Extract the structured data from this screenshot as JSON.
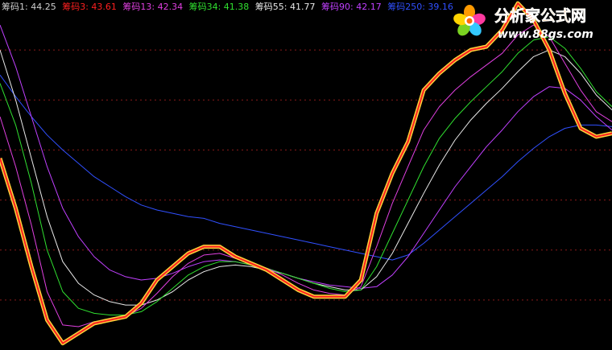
{
  "colors": {
    "background": "#000000",
    "grid": "#8a1a1a"
  },
  "legend": [
    {
      "label": "筹码1: 44.25",
      "color": "#cfcfcf"
    },
    {
      "label": "筹码3: 43.61",
      "color": "#ff2020"
    },
    {
      "label": "筹码13: 42.34",
      "color": "#e040e0"
    },
    {
      "label": "筹码34: 41.38",
      "color": "#30e030"
    },
    {
      "label": "筹码55: 41.77",
      "color": "#e8e8e8"
    },
    {
      "label": "筹码90: 42.17",
      "color": "#c040ff"
    },
    {
      "label": "筹码250: 39.16",
      "color": "#3050ff"
    }
  ],
  "watermark": {
    "site_name": "分析家公式网",
    "url": "www.88gs.com",
    "icon": "flower-logo-icon"
  },
  "chart_data": {
    "type": "line",
    "grid": "horizontal-dashed",
    "legend_placement": "top-left",
    "ylim": [
      30,
      51
    ],
    "x": [
      0,
      4,
      8,
      12,
      16,
      20,
      24,
      28,
      32,
      36,
      40,
      44,
      48,
      52,
      56,
      60,
      64,
      68,
      72,
      76,
      80,
      84,
      88,
      92,
      96,
      100,
      104,
      108,
      112,
      116,
      120,
      124,
      128,
      132,
      136,
      140,
      144,
      148,
      152,
      156
    ],
    "series": [
      {
        "name": "筹码1",
        "color": "#ffd23a",
        "thick": true,
        "values": [
          41.5,
          38.5,
          35.0,
          31.8,
          30.4,
          31.0,
          31.6,
          31.8,
          32.0,
          32.8,
          34.2,
          35.0,
          35.8,
          36.2,
          36.2,
          35.6,
          35.2,
          34.8,
          34.2,
          33.6,
          33.2,
          33.2,
          33.2,
          34.2,
          38.2,
          40.6,
          42.5,
          45.6,
          46.6,
          47.4,
          48.0,
          48.2,
          49.2,
          50.8,
          49.8,
          48.0,
          45.4,
          43.3,
          42.8,
          43.0
        ]
      },
      {
        "name": "筹码3",
        "color": "#ff2020",
        "thick": true,
        "values": [
          41.5,
          38.5,
          35.0,
          31.8,
          30.4,
          31.0,
          31.6,
          31.8,
          32.0,
          32.8,
          34.2,
          35.0,
          35.8,
          36.2,
          36.2,
          35.6,
          35.2,
          34.8,
          34.2,
          33.6,
          33.2,
          33.2,
          33.2,
          34.2,
          38.2,
          40.6,
          42.5,
          45.6,
          46.6,
          47.4,
          48.0,
          48.2,
          49.2,
          50.8,
          49.8,
          48.0,
          45.4,
          43.3,
          42.8,
          43.0
        ]
      },
      {
        "name": "筹码13",
        "color": "#e040e0",
        "values": [
          44.0,
          41.0,
          37.5,
          33.5,
          31.5,
          31.4,
          31.7,
          31.8,
          32.0,
          32.5,
          33.4,
          34.4,
          35.2,
          35.7,
          35.8,
          35.5,
          35.2,
          34.9,
          34.5,
          34.0,
          33.6,
          33.4,
          33.3,
          33.8,
          36.2,
          38.8,
          41.0,
          43.2,
          44.6,
          45.6,
          46.4,
          47.1,
          47.8,
          48.9,
          49.5,
          48.8,
          47.2,
          45.6,
          44.3,
          43.7
        ]
      },
      {
        "name": "筹码34",
        "color": "#30e030",
        "values": [
          46.0,
          43.5,
          40.0,
          36.0,
          33.5,
          32.5,
          32.2,
          32.1,
          32.1,
          32.3,
          32.9,
          33.7,
          34.5,
          35.0,
          35.3,
          35.3,
          35.1,
          34.9,
          34.6,
          34.3,
          34.0,
          33.7,
          33.5,
          33.6,
          35.0,
          37.0,
          39.0,
          41.0,
          42.7,
          43.9,
          44.9,
          45.8,
          46.7,
          47.8,
          48.6,
          48.8,
          48.1,
          46.9,
          45.5,
          44.6
        ]
      },
      {
        "name": "筹码55",
        "color": "#e8e8e8",
        "values": [
          48.0,
          45.0,
          41.5,
          38.0,
          35.3,
          34.0,
          33.3,
          32.9,
          32.7,
          32.7,
          33.0,
          33.5,
          34.2,
          34.7,
          35.0,
          35.1,
          35.0,
          34.8,
          34.6,
          34.3,
          34.0,
          33.8,
          33.6,
          33.6,
          34.4,
          35.8,
          37.6,
          39.4,
          41.1,
          42.6,
          43.8,
          44.8,
          45.7,
          46.7,
          47.6,
          48.0,
          47.6,
          46.6,
          45.3,
          44.4
        ]
      },
      {
        "name": "筹码90",
        "color": "#c040ff",
        "values": [
          49.5,
          47.0,
          44.0,
          41.0,
          38.5,
          36.8,
          35.6,
          34.8,
          34.4,
          34.2,
          34.3,
          34.6,
          35.0,
          35.3,
          35.4,
          35.3,
          35.1,
          34.9,
          34.6,
          34.3,
          34.1,
          33.9,
          33.8,
          33.7,
          33.8,
          34.5,
          35.6,
          37.0,
          38.4,
          39.8,
          41.0,
          42.2,
          43.2,
          44.3,
          45.2,
          45.8,
          45.7,
          45.0,
          44.0,
          43.2
        ]
      },
      {
        "name": "筹码250",
        "color": "#3050ff",
        "values": [
          46.5,
          45.2,
          44.0,
          42.9,
          42.0,
          41.2,
          40.4,
          39.8,
          39.2,
          38.7,
          38.4,
          38.2,
          38.0,
          37.9,
          37.6,
          37.4,
          37.2,
          37.0,
          36.8,
          36.6,
          36.4,
          36.2,
          36.0,
          35.8,
          35.6,
          35.4,
          35.7,
          36.4,
          37.2,
          38.0,
          38.8,
          39.6,
          40.4,
          41.3,
          42.1,
          42.8,
          43.3,
          43.5,
          43.5,
          43.4
        ]
      }
    ],
    "gridlines": [
      48,
      45,
      42,
      39,
      36,
      33
    ]
  }
}
